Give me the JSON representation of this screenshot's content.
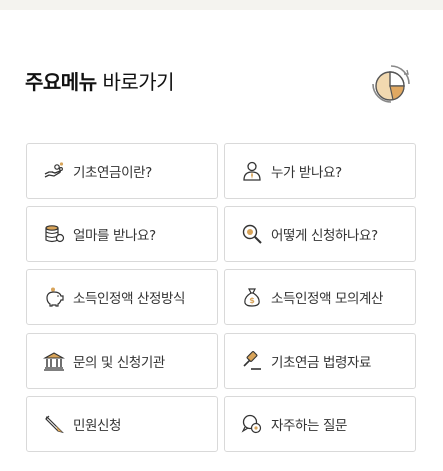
{
  "section": {
    "title_bold": "주요메뉴",
    "title_light": " 바로가기",
    "icon": "pie-chart-icon"
  },
  "menu": [
    {
      "label": "기초연금이란?",
      "icon": "hand-coins-icon"
    },
    {
      "label": "누가 받나요?",
      "icon": "person-icon"
    },
    {
      "label": "얼마를 받나요?",
      "icon": "coin-stack-icon"
    },
    {
      "label": "어떻게 신청하나요?",
      "icon": "magnifier-icon"
    },
    {
      "label": "소득인정액 산정방식",
      "icon": "piggy-bank-icon"
    },
    {
      "label": "소득인정액 모의계산",
      "icon": "money-bag-icon"
    },
    {
      "label": "문의 및 신청기관",
      "icon": "institution-icon"
    },
    {
      "label": "기초연금 법령자료",
      "icon": "gavel-icon"
    },
    {
      "label": "민원신청",
      "icon": "pen-icon"
    },
    {
      "label": "자주하는 질문",
      "icon": "question-bubble-icon"
    }
  ],
  "colors": {
    "accent": "#d8a45a",
    "border": "#d9d9d9",
    "text": "#333333"
  }
}
